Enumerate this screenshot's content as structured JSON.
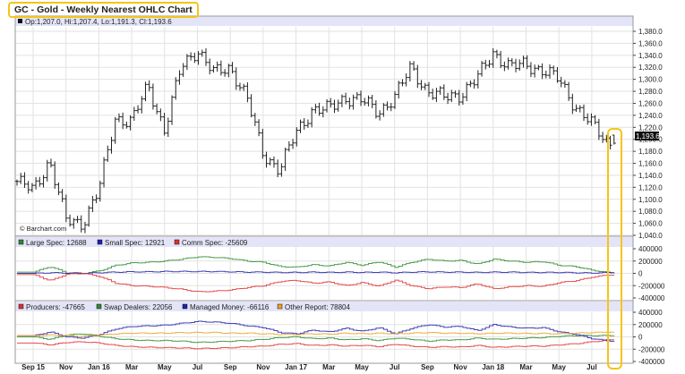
{
  "title": "GC - Gold - Weekly Nearest OHLC Chart",
  "price_legend": "Op:1,207.0, Hi:1,207.4, Lo:1,191.3, Cl:1,193.6",
  "last_price_label": "1,193.6",
  "watermark": "© Barchart.com",
  "colors": {
    "highlight": "#f5c518",
    "header_band": "#e4e4f8",
    "grid": "#e2e2e2",
    "bar": "#222222",
    "green": "#2e8b2e",
    "blue": "#2020b0",
    "red": "#e03030",
    "orange": "#f0a020"
  },
  "chart_data": [
    {
      "type": "ohlc",
      "title": "GC - Gold - Weekly Nearest OHLC Chart",
      "ylim": [
        1040,
        1380
      ],
      "y_ticks": [
        "1,380.0",
        "1,360.0",
        "1,340.0",
        "1,320.0",
        "1,300.0",
        "1,280.0",
        "1,260.0",
        "1,240.0",
        "1,220.0",
        "1,200.0",
        "1,180.0",
        "1,160.0",
        "1,140.0",
        "1,120.0",
        "1,100.0",
        "1,080.0",
        "1,060.0",
        "1,040.0"
      ],
      "y_tick_values": [
        1380,
        1360,
        1340,
        1320,
        1300,
        1280,
        1260,
        1240,
        1220,
        1200,
        1180,
        1160,
        1140,
        1120,
        1100,
        1080,
        1060,
        1040
      ],
      "monthly_close_from_aug15": [
        1130,
        1115,
        1165,
        1065,
        1060,
        1115,
        1235,
        1230,
        1290,
        1215,
        1320,
        1350,
        1310,
        1320,
        1270,
        1175,
        1150,
        1210,
        1250,
        1250,
        1270,
        1265,
        1245,
        1270,
        1320,
        1280,
        1270,
        1275,
        1300,
        1345,
        1320,
        1325,
        1315,
        1300,
        1255,
        1225,
        1194
      ],
      "last_bar": {
        "open": 1207.0,
        "high": 1207.4,
        "low": 1191.3,
        "close": 1193.6
      }
    },
    {
      "type": "line",
      "title": "COT Legacy",
      "ylim": [
        -400000,
        400000
      ],
      "y_ticks": [
        "400000",
        "200000",
        "0",
        "-200000",
        "-400000"
      ],
      "y_tick_values": [
        400000,
        200000,
        0,
        -200000,
        -400000
      ],
      "x_start": "Sep 15",
      "series": [
        {
          "name": "Large Spec",
          "label": "Large Spec: 12688",
          "color": "#2e8b2e",
          "values": [
            20000,
            110000,
            10000,
            0,
            40000,
            130000,
            170000,
            180000,
            200000,
            230000,
            270000,
            260000,
            240000,
            200000,
            180000,
            110000,
            100000,
            140000,
            120000,
            180000,
            130000,
            190000,
            100000,
            180000,
            230000,
            200000,
            210000,
            150000,
            230000,
            200000,
            180000,
            190000,
            130000,
            110000,
            50000,
            12688
          ]
        },
        {
          "name": "Small Spec",
          "label": "Small Spec: 12921",
          "color": "#2020b0",
          "values": [
            0,
            10000,
            5000,
            0,
            10000,
            20000,
            25000,
            25000,
            30000,
            30000,
            30000,
            30000,
            25000,
            20000,
            20000,
            15000,
            15000,
            20000,
            15000,
            20000,
            15000,
            20000,
            10000,
            20000,
            25000,
            20000,
            20000,
            15000,
            20000,
            20000,
            15000,
            15000,
            15000,
            10000,
            5000,
            12921
          ]
        },
        {
          "name": "Comm Spec",
          "label": "Comm Spec: -25609",
          "color": "#e03030",
          "values": [
            -20000,
            -120000,
            -15000,
            0,
            -50000,
            -160000,
            -200000,
            -210000,
            -230000,
            -260000,
            -300000,
            -290000,
            -270000,
            -230000,
            -200000,
            -130000,
            -115000,
            -160000,
            -140000,
            -200000,
            -150000,
            -210000,
            -110000,
            -200000,
            -250000,
            -220000,
            -230000,
            -170000,
            -250000,
            -220000,
            -200000,
            -210000,
            -150000,
            -120000,
            -60000,
            -25609
          ]
        }
      ]
    },
    {
      "type": "line",
      "title": "COT Disaggregated",
      "ylim": [
        -400000,
        400000
      ],
      "y_ticks": [
        "400000",
        "200000",
        "0",
        "-200000",
        "-400000"
      ],
      "y_tick_values": [
        400000,
        200000,
        0,
        -200000,
        -400000
      ],
      "x_start": "Sep 15",
      "series": [
        {
          "name": "Producers",
          "label": "Producers: -47665",
          "color": "#e03030",
          "values": [
            -100000,
            -130000,
            -90000,
            -80000,
            -100000,
            -140000,
            -160000,
            -170000,
            -175000,
            -180000,
            -190000,
            -185000,
            -175000,
            -160000,
            -150000,
            -120000,
            -110000,
            -140000,
            -130000,
            -150000,
            -135000,
            -160000,
            -120000,
            -150000,
            -170000,
            -160000,
            -165000,
            -140000,
            -170000,
            -160000,
            -150000,
            -150000,
            -130000,
            -110000,
            -80000,
            -47665
          ]
        },
        {
          "name": "Swap Dealers",
          "label": "Swap Dealers: 22056",
          "color": "#2e8b2e",
          "values": [
            0,
            -40000,
            30000,
            50000,
            10000,
            -30000,
            -50000,
            -60000,
            -60000,
            -70000,
            -90000,
            -80000,
            -70000,
            -60000,
            -40000,
            -10000,
            0,
            -30000,
            -20000,
            -50000,
            -30000,
            -60000,
            -20000,
            -40000,
            -70000,
            -50000,
            -50000,
            -20000,
            -40000,
            -30000,
            -20000,
            -10000,
            10000,
            20000,
            20000,
            22056
          ]
        },
        {
          "name": "Managed Money",
          "label": "Managed Money: -66116",
          "color": "#2020b0",
          "values": [
            20000,
            80000,
            0,
            -20000,
            40000,
            130000,
            170000,
            180000,
            190000,
            220000,
            250000,
            240000,
            220000,
            180000,
            150000,
            70000,
            50000,
            110000,
            80000,
            140000,
            90000,
            150000,
            50000,
            140000,
            200000,
            160000,
            170000,
            100000,
            200000,
            160000,
            140000,
            150000,
            80000,
            40000,
            -30000,
            -66116
          ]
        },
        {
          "name": "Other Report",
          "label": "Other Report: 78804",
          "color": "#f0a020",
          "values": [
            20000,
            30000,
            20000,
            10000,
            30000,
            50000,
            60000,
            60000,
            60000,
            70000,
            70000,
            70000,
            60000,
            60000,
            50000,
            40000,
            40000,
            50000,
            45000,
            60000,
            50000,
            60000,
            50000,
            60000,
            70000,
            60000,
            60000,
            50000,
            60000,
            60000,
            55000,
            55000,
            50000,
            60000,
            70000,
            78804
          ]
        }
      ]
    }
  ],
  "x_labels": [
    "Sep 15",
    "Nov",
    "Jan 16",
    "Mar",
    "May",
    "Jul",
    "Sep",
    "Nov",
    "Jan 17",
    "Mar",
    "May",
    "Jul",
    "Sep",
    "Nov",
    "Jan 18",
    "Mar",
    "May",
    "Jul"
  ],
  "x_label_month_index": [
    0,
    2,
    4,
    6,
    8,
    10,
    12,
    14,
    16,
    18,
    20,
    22,
    24,
    26,
    28,
    30,
    32,
    34
  ]
}
